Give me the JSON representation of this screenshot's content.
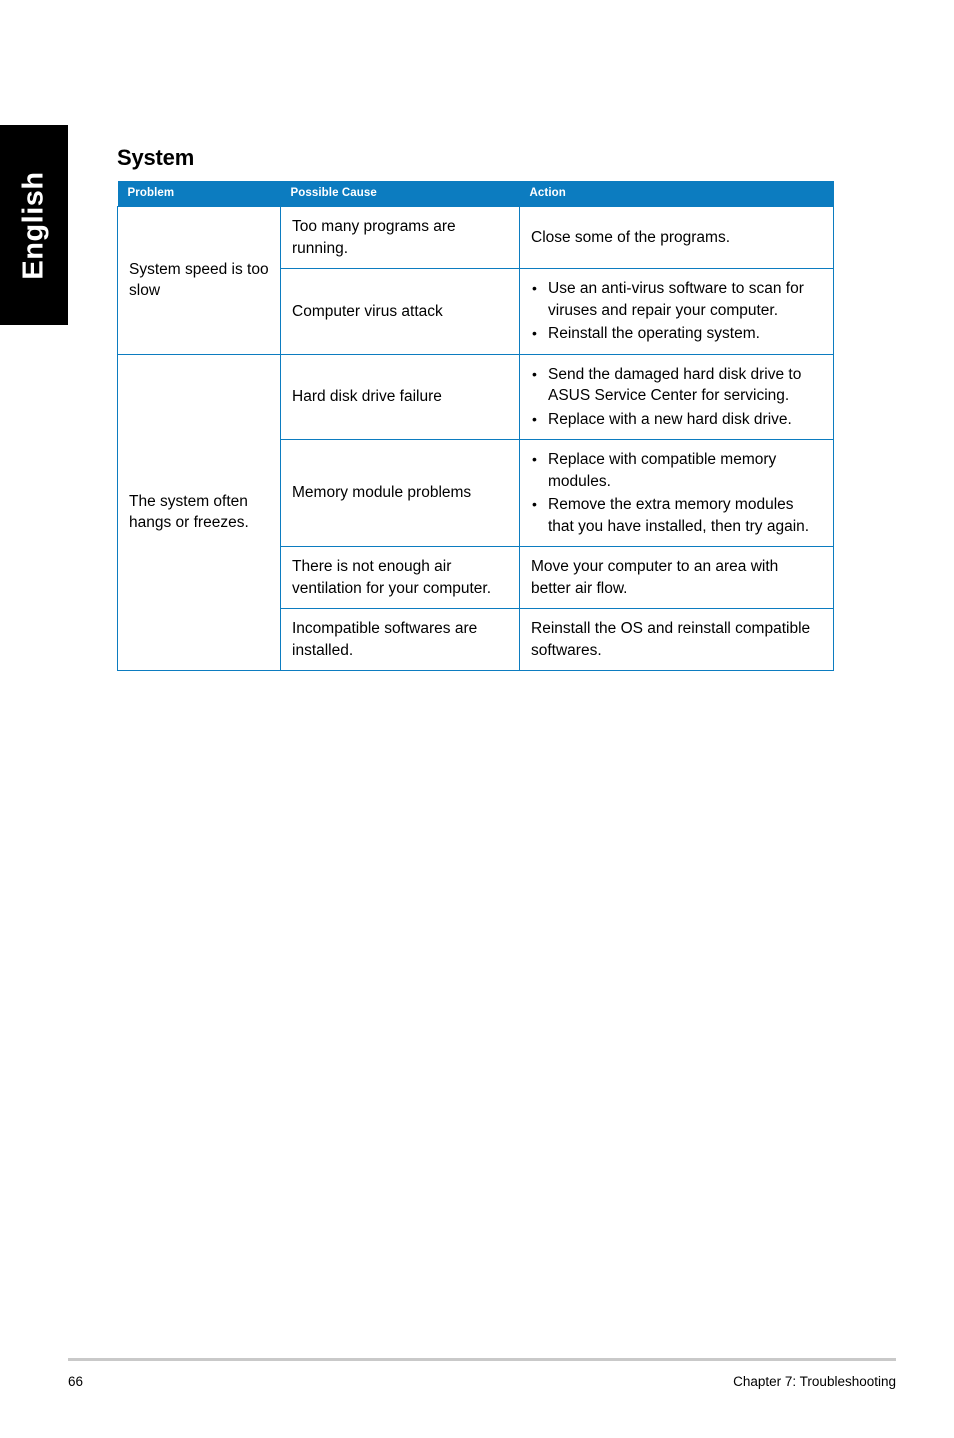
{
  "language_tab": {
    "label": "English"
  },
  "section": {
    "title": "System"
  },
  "table": {
    "headers": {
      "problem": "Problem",
      "possible_cause": "Possible Cause",
      "action": "Action"
    },
    "accent_color": "#0c7cc0",
    "groups": [
      {
        "problem": "System speed is too slow",
        "rows": [
          {
            "cause": "Too many programs are running.",
            "action_text": "Close some of the programs.",
            "action_bullets": []
          },
          {
            "cause": "Computer virus attack",
            "action_text": "",
            "action_bullets": [
              "Use an anti-virus software to scan for viruses and repair your computer.",
              "Reinstall the operating system."
            ]
          }
        ]
      },
      {
        "problem": "The system often hangs or freezes.",
        "rows": [
          {
            "cause": "Hard disk drive failure",
            "action_text": "",
            "action_bullets": [
              "Send the damaged hard disk drive to ASUS Service Center for servicing.",
              "Replace with a new hard disk drive."
            ]
          },
          {
            "cause": "Memory module problems",
            "action_text": "",
            "action_bullets": [
              "Replace with compatible memory modules.",
              "Remove the extra memory modules that you have installed, then try again."
            ]
          },
          {
            "cause": "There is not enough air ventilation for your computer.",
            "action_text": "Move your computer to an area with better air flow.",
            "action_bullets": []
          },
          {
            "cause": "Incompatible softwares are installed.",
            "action_text": "Reinstall the OS and reinstall compatible softwares.",
            "action_bullets": []
          }
        ]
      }
    ]
  },
  "footer": {
    "page_number": "66",
    "chapter": "Chapter 7: Troubleshooting"
  },
  "bullet_glyph": "•"
}
